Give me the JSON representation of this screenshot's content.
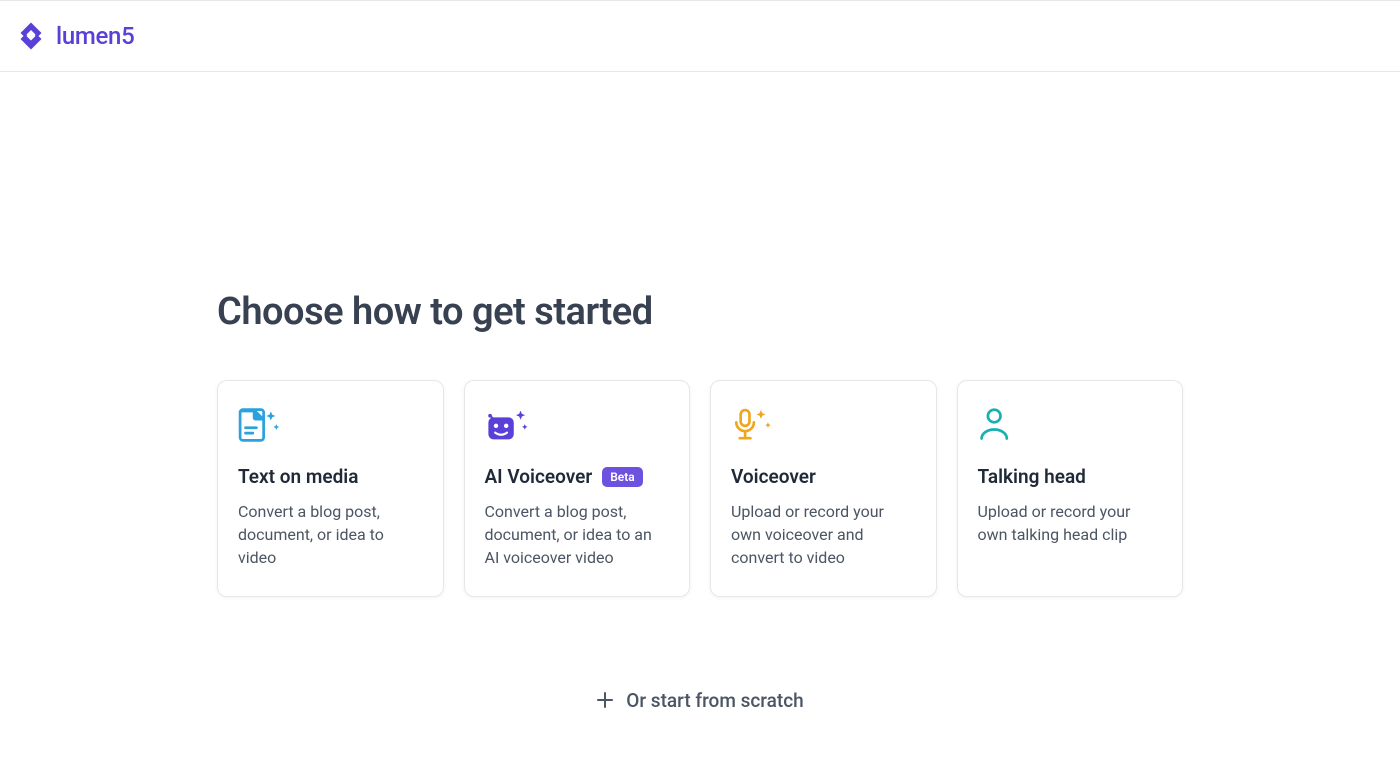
{
  "brand": {
    "name": "lumen5",
    "color": "#5a40d8"
  },
  "page": {
    "heading": "Choose how to get started"
  },
  "cards": [
    {
      "icon": "text-doc-sparkle-icon",
      "iconColor": "#2aa2de",
      "title": "Text on media",
      "badge": null,
      "description": "Convert a blog post, document, or idea to video"
    },
    {
      "icon": "ai-bot-sparkle-icon",
      "iconColor": "#5a40d8",
      "title": "AI Voiceover",
      "badge": "Beta",
      "description": "Convert a blog post, document, or idea to an AI voiceover video"
    },
    {
      "icon": "mic-sparkle-icon",
      "iconColor": "#f0a51a",
      "title": "Voiceover",
      "badge": null,
      "description": "Upload or record your own voiceover and convert to video"
    },
    {
      "icon": "person-icon",
      "iconColor": "#1bb0b0",
      "title": "Talking head",
      "badge": null,
      "description": "Upload or record your own talking head clip"
    }
  ],
  "scratch": {
    "label": "Or start from scratch"
  }
}
